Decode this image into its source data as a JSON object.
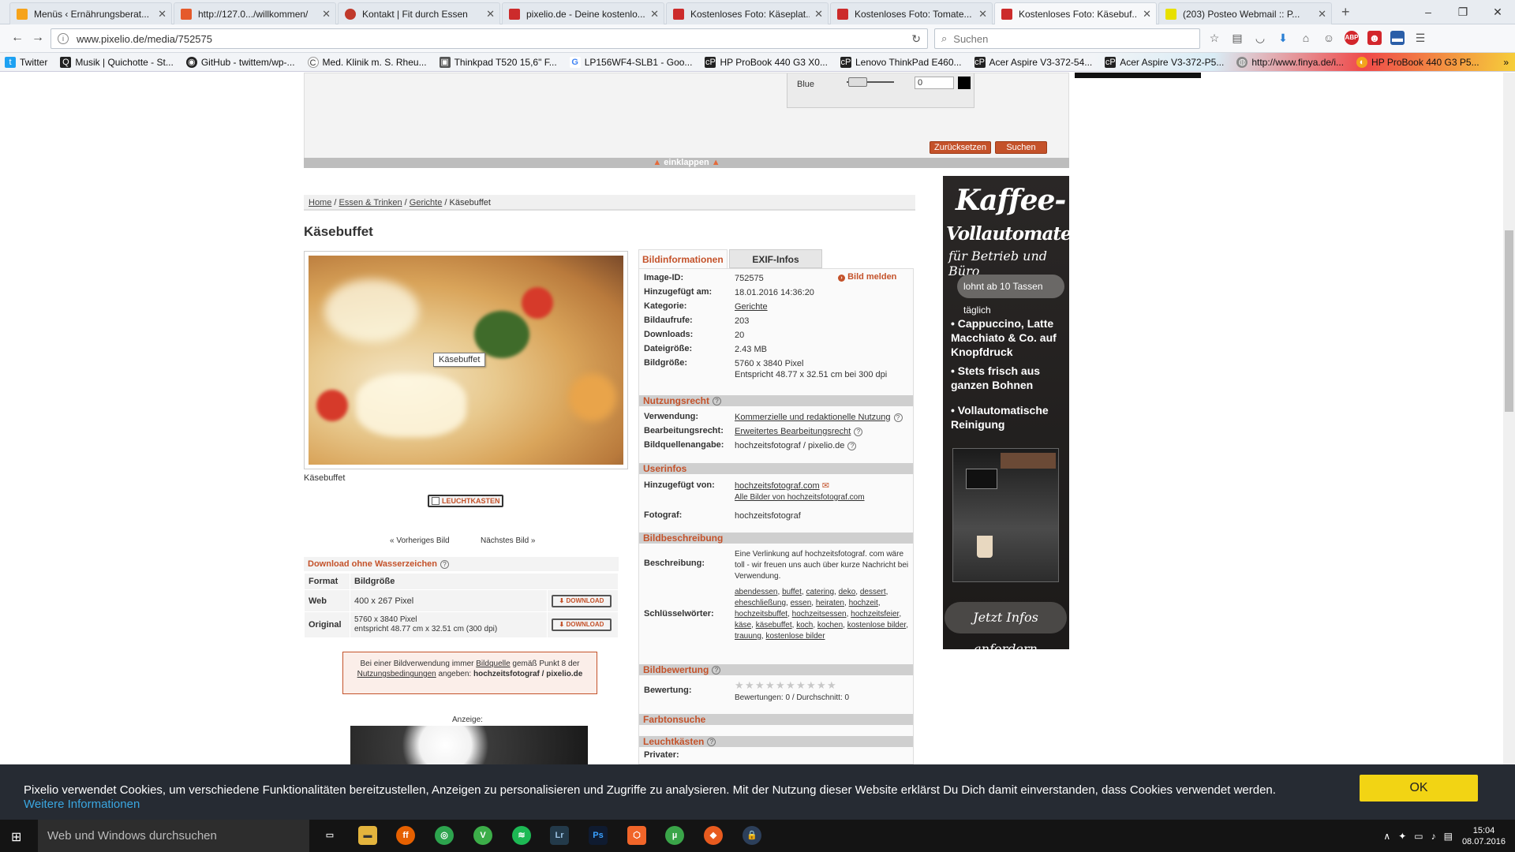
{
  "browser": {
    "tabs": [
      {
        "title": "Menüs ‹ Ernährungsberat...",
        "color": "#f6a31b"
      },
      {
        "title": "http://127.0.../willkommen/",
        "color": "#e55a2b"
      },
      {
        "title": "Kontakt | Fit durch Essen",
        "color": "#c0392b"
      },
      {
        "title": "pixelio.de - Deine kostenlo...",
        "color": "#cc2b2b"
      },
      {
        "title": "Kostenloses Foto: Käseplat...",
        "color": "#cc2b2b"
      },
      {
        "title": "Kostenloses Foto: Tomate...",
        "color": "#cc2b2b"
      },
      {
        "title": "Kostenloses Foto: Käsebuf...",
        "color": "#cc2b2b",
        "active": true
      },
      {
        "title": "(203) Posteo Webmail :: P...",
        "color": "#e8e000"
      }
    ],
    "url": "www.pixelio.de/media/752575",
    "search_placeholder": "Suchen",
    "bookmarks": [
      "Twitter",
      "Musik | Quichotte - St...",
      "GitHub - twittem/wp-...",
      "Med. Klinik m. S. Rheu...",
      "Thinkpad T520 15,6\" F...",
      "LP156WF4-SLB1 - Goo...",
      "HP ProBook 440 G3 X0...",
      "Lenovo ThinkPad E460...",
      "Acer Aspire V3-372-54...",
      "Acer Aspire V3-372-P5...",
      "http://www.finya.de/i...",
      "HP ProBook 440 G3 P5..."
    ]
  },
  "page": {
    "color_label": "Blue",
    "color_value": "0",
    "reset_label": "Zurücksetzen",
    "search_label": "Suchen",
    "collapse_label": "einklappen",
    "breadcrumb": [
      "Home",
      "Essen & Trinken",
      "Gerichte",
      "Käsebuffet"
    ],
    "title": "Käsebuffet",
    "image_tooltip": "Käsebuffet",
    "image_caption": "Käsebuffet",
    "lightbox_label": "LEUCHTKASTEN",
    "prev_label": "« Vorheriges Bild",
    "next_label": "Nächstes Bild »",
    "download": {
      "heading": "Download ohne Wasserzeichen",
      "col_format": "Format",
      "col_size": "Bildgröße",
      "rows": [
        {
          "format": "Web",
          "size": "400 x 267 Pixel",
          "size2": "",
          "button": "DOWNLOAD"
        },
        {
          "format": "Original",
          "size": "5760 x 3840 Pixel",
          "size2": "entspricht 48.77 cm x 32.51 cm (300 dpi)",
          "button": "DOWNLOAD"
        }
      ]
    },
    "notice": {
      "p1": "Bei einer Bildverwendung immer",
      "link1": "Bildquelle",
      "p2": "gemäß Punkt 8 der",
      "link2": "Nutzungsbedingungen",
      "p3": "angeben:",
      "credit": "hochzeitsfotograf / pixelio.de"
    },
    "ad_label": "Anzeige:"
  },
  "info": {
    "tab_active": "Bildinformationen",
    "tab_exif": "EXIF-Infos",
    "report": "Bild melden",
    "fields": {
      "id_k": "Image-ID:",
      "id_v": "752575",
      "added_k": "Hinzugefügt am:",
      "added_v": "18.01.2016 14:36:20",
      "cat_k": "Kategorie:",
      "cat_v": "Gerichte",
      "views_k": "Bildaufrufe:",
      "views_v": "203",
      "dl_k": "Downloads:",
      "dl_v": "20",
      "fs_k": "Dateigröße:",
      "fs_v": "2.43 MB",
      "bs_k": "Bildgröße:",
      "bs_v": "5760 x 3840 Pixel",
      "bs_v2": "Entspricht 48.77 x 32.51 cm bei 300 dpi"
    },
    "usage": {
      "heading": "Nutzungsrecht",
      "use_k": "Verwendung:",
      "use_v": "Kommerzielle und redaktionelle Nutzung",
      "edit_k": "Bearbeitungsrecht:",
      "edit_v": "Erweitertes Bearbeitungsrecht",
      "src_k": "Bildquellenangabe:",
      "src_v": "hochzeitsfotograf / pixelio.de"
    },
    "user": {
      "heading": "Userinfos",
      "by_k": "Hinzugefügt von:",
      "by_v": "hochzeitsfotograf.com",
      "all_v": "Alle Bilder von hochzeitsfotograf.com",
      "photo_k": "Fotograf:",
      "photo_v": "hochzeitsfotograf"
    },
    "desc": {
      "heading": "Bildbeschreibung",
      "desc_k": "Beschreibung:",
      "desc_v": "Eine Verlinkung auf hochzeitsfotograf. com wäre toll - wir freuen uns auch über kurze Nachricht bei Verwendung.",
      "kw_k": "Schlüsselwörter:",
      "keywords": [
        "abendessen",
        "buffet",
        "catering",
        "deko",
        "dessert",
        "eheschließung",
        "essen",
        "heiraten",
        "hochzeit",
        "hochzeitsbuffet",
        "hochzeitsessen",
        "hochzeitsfeier",
        "käse",
        "käsebuffet",
        "koch",
        "kochen",
        "kostenlose bilder",
        "trauung",
        "kostenlose bilder"
      ]
    },
    "rating": {
      "heading": "Bildbewertung",
      "k": "Bewertung:",
      "stars": 0,
      "stars_max": 10,
      "summary": "Bewertungen: 0 / Durchschnitt: 0"
    },
    "color_heading": "Farbtonsuche",
    "lightbox_heading": "Leuchtkästen",
    "private_k": "Privater:"
  },
  "sidead": {
    "title1": "Kaffee-",
    "title2": "Vollautomaten",
    "title3": "für Betrieb und Büro",
    "pill": "lohnt ab 10 Tassen täglich",
    "bullets": [
      "Cappuccino, Latte Macchiato & Co. auf Knopfdruck",
      "Stets frisch aus ganzen Bohnen",
      "Vollautomatische Reinigung"
    ],
    "cta": "Jetzt Infos anfordern"
  },
  "cookie": {
    "text": "Pixelio verwendet Cookies, um verschiedene Funktionalitäten bereitzustellen, Anzeigen zu personalisieren und Zugriffe zu analysieren. Mit der Nutzung dieser Website erklärst Du Dich damit einverstanden, dass Cookies verwendet werden.",
    "more": "Weitere Informationen",
    "ok": "OK"
  },
  "taskbar": {
    "search": "Web und Windows durchsuchen",
    "time": "15:04",
    "date": "08.07.2016"
  }
}
